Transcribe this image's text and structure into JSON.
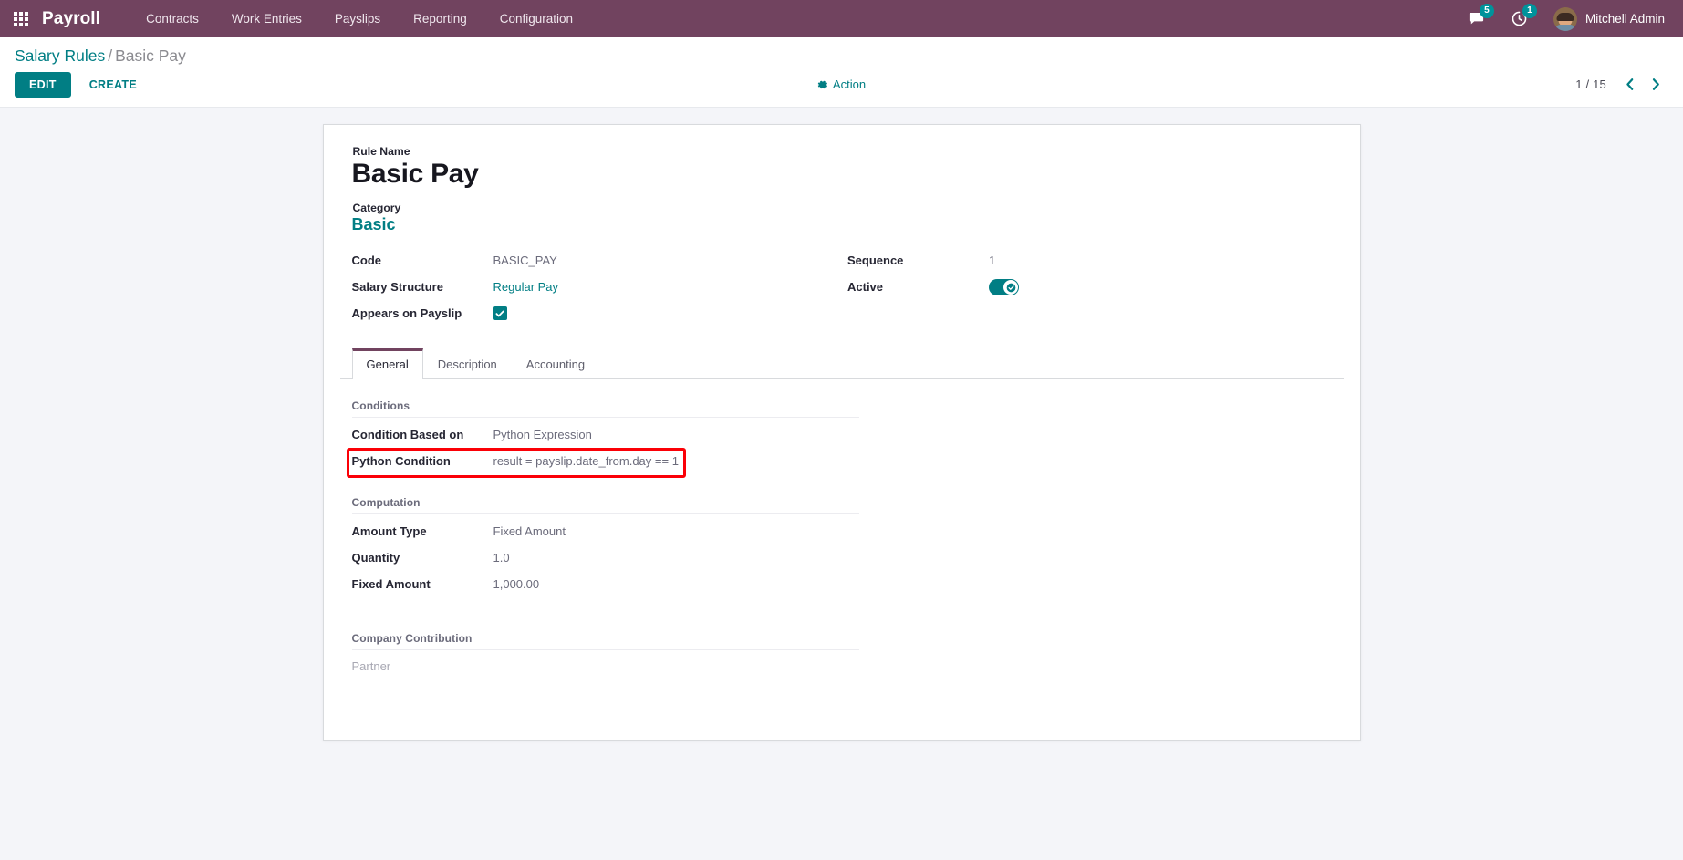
{
  "navbar": {
    "apps_icon": "apps-grid-icon",
    "brand": "Payroll",
    "menus": [
      {
        "label": "Contracts"
      },
      {
        "label": "Work Entries"
      },
      {
        "label": "Payslips"
      },
      {
        "label": "Reporting"
      },
      {
        "label": "Configuration"
      }
    ],
    "messages": {
      "icon": "chat-bubble-icon",
      "count": "5"
    },
    "activities": {
      "icon": "clock-activity-icon",
      "count": "1"
    },
    "user": {
      "name": "Mitchell Admin",
      "avatar": "user-avatar"
    },
    "bg_color": "#71435f"
  },
  "control_panel": {
    "breadcrumb": {
      "parent": "Salary Rules",
      "separator": "/",
      "current": "Basic Pay"
    },
    "buttons": {
      "edit": "EDIT",
      "create": "CREATE"
    },
    "action": {
      "label": "Action",
      "icon": "gear-icon"
    },
    "pager": {
      "value": "1 / 15",
      "prev_icon": "chevron-left-icon",
      "next_icon": "chevron-right-icon"
    }
  },
  "form": {
    "title_label": "Rule Name",
    "title_value": "Basic Pay",
    "category_label": "Category",
    "category_value": "Basic",
    "left_fields": [
      {
        "label": "Code",
        "value": "BASIC_PAY",
        "type": "text"
      },
      {
        "label": "Salary Structure",
        "value": "Regular Pay",
        "type": "link"
      },
      {
        "label": "Appears on Payslip",
        "value": "",
        "type": "checkbox",
        "checked": true
      }
    ],
    "right_fields": [
      {
        "label": "Sequence",
        "value": "1",
        "type": "text"
      },
      {
        "label": "Active",
        "value": "",
        "type": "toggle",
        "checked": true
      }
    ],
    "tabs": [
      {
        "label": "General",
        "active": true
      },
      {
        "label": "Description",
        "active": false
      },
      {
        "label": "Accounting",
        "active": false
      }
    ],
    "general_tab": {
      "conditions": {
        "title": "Conditions",
        "fields": [
          {
            "label": "Condition Based on",
            "value": "Python Expression"
          },
          {
            "label": "Python Condition",
            "value": "result = payslip.date_from.day == 1",
            "highlighted": true
          }
        ]
      },
      "computation": {
        "title": "Computation",
        "fields": [
          {
            "label": "Amount Type",
            "value": "Fixed Amount"
          },
          {
            "label": "Quantity",
            "value": "1.0"
          },
          {
            "label": "Fixed Amount",
            "value": "1,000.00"
          }
        ]
      },
      "company_contribution": {
        "title": "Company Contribution",
        "partner_label": "Partner"
      }
    }
  },
  "colors": {
    "brand_purple": "#71435f",
    "accent_teal": "#017e84",
    "annotation_red": "#fb0007",
    "page_bg": "#f4f5f9"
  }
}
